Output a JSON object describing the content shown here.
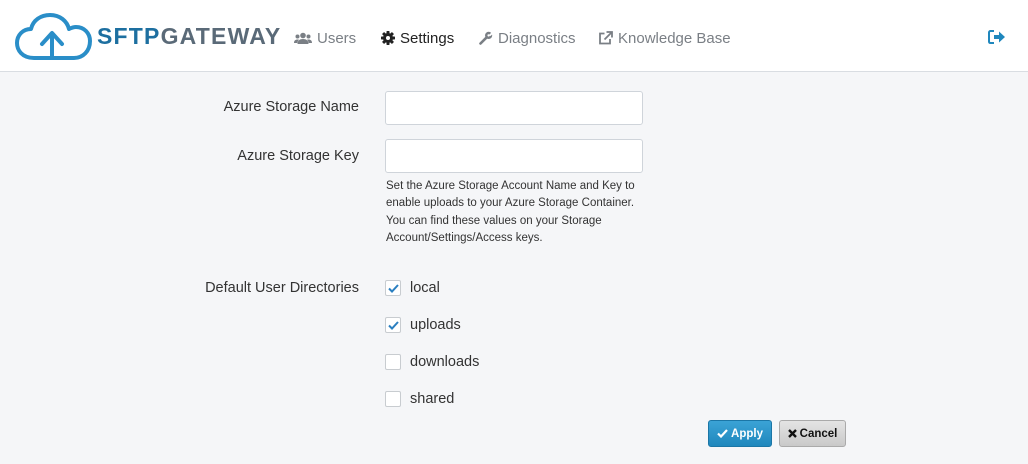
{
  "brand": {
    "part1": "SFTP",
    "part2": "GATEWAY"
  },
  "nav": {
    "users": "Users",
    "settings": "Settings",
    "diagnostics": "Diagnostics",
    "knowledge_base": "Knowledge Base",
    "active": "settings"
  },
  "icons": {
    "logo": "cloud-upload-icon",
    "users": "users-icon",
    "settings": "gear-icon",
    "diagnostics": "wrench-icon",
    "knowledge_base": "external-link-icon",
    "logout": "sign-out-icon",
    "apply": "check-icon",
    "cancel": "close-icon"
  },
  "colors": {
    "brand_blue": "#1d6fa0",
    "brand_gray": "#5a6a78",
    "accent": "#2a8ec8",
    "page_bg": "#f5f6f8"
  },
  "form": {
    "azure_storage_name": {
      "label": "Azure Storage Name",
      "value": ""
    },
    "azure_storage_key": {
      "label": "Azure Storage Key",
      "value": ""
    },
    "help_text": "Set the Azure Storage Account Name and Key to enable uploads to your Azure Storage Container. You can find these values on your Storage Account/Settings/Access keys.",
    "default_dirs_label": "Default User Directories",
    "directories": [
      {
        "label": "local",
        "checked": true
      },
      {
        "label": "uploads",
        "checked": true
      },
      {
        "label": "downloads",
        "checked": false
      },
      {
        "label": "shared",
        "checked": false
      }
    ]
  },
  "buttons": {
    "apply": "Apply",
    "cancel": "Cancel"
  }
}
